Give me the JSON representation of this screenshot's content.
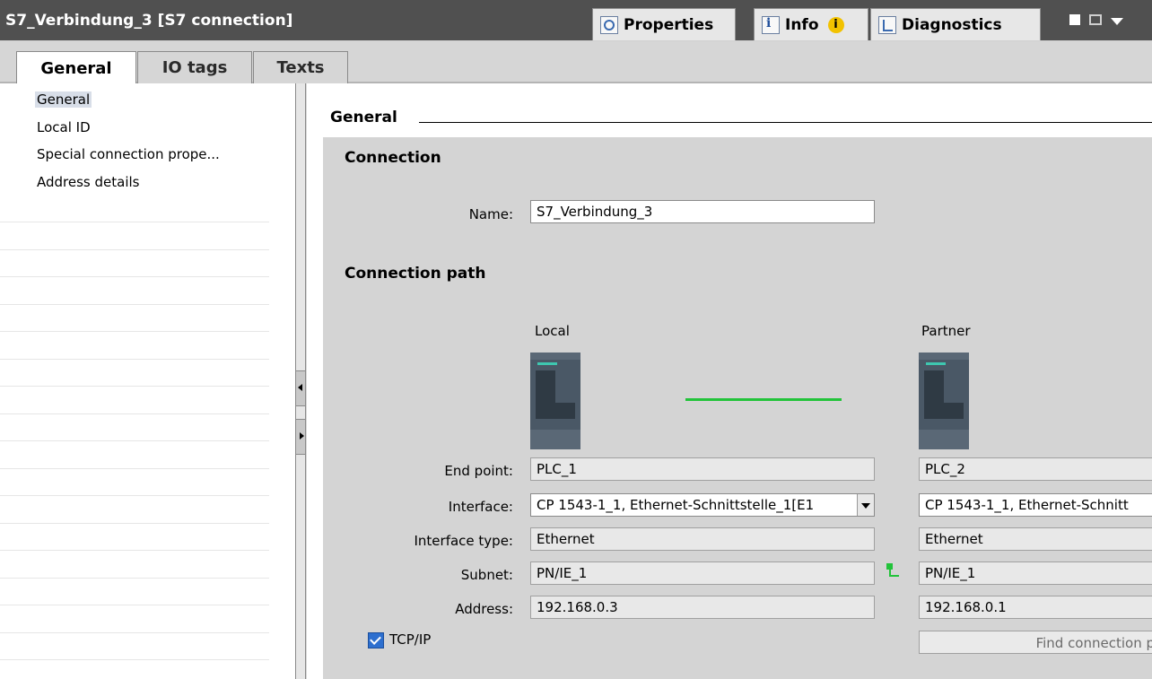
{
  "window": {
    "title": "S7_Verbindung_3 [S7 connection]",
    "tabs": [
      {
        "label": "Properties",
        "icon": "properties-icon"
      },
      {
        "label": "Info",
        "icon": "info-icon"
      },
      {
        "label": "Diagnostics",
        "icon": "diagnostics-icon"
      }
    ],
    "info_badge": "i"
  },
  "subtabs": [
    "General",
    "IO tags",
    "Texts"
  ],
  "sidebar": {
    "items": [
      {
        "label": "General"
      },
      {
        "label": "Local ID"
      },
      {
        "label": "Special connection prope..."
      },
      {
        "label": "Address details"
      }
    ]
  },
  "main": {
    "section_title": "General",
    "connection": {
      "heading": "Connection",
      "name_label": "Name:",
      "name_value": "S7_Verbindung_3"
    },
    "path": {
      "heading": "Connection path",
      "local_label": "Local",
      "partner_label": "Partner",
      "rows": [
        {
          "label": "End point:",
          "local": "PLC_1",
          "partner": "PLC_2"
        },
        {
          "label": "Interface:",
          "local": "CP 1543-1_1, Ethernet-Schnittstelle_1[E1",
          "partner": "CP 1543-1_1, Ethernet-Schnitt"
        },
        {
          "label": "Interface type:",
          "local": "Ethernet",
          "partner": "Ethernet"
        },
        {
          "label": "Subnet:",
          "local": "PN/IE_1",
          "partner": "PN/IE_1"
        },
        {
          "label": "Address:",
          "local": "192.168.0.3",
          "partner": "192.168.0.1"
        }
      ],
      "tcpip_label": "TCP/IP",
      "find_button": "Find connection p"
    }
  },
  "colors": {
    "link_line": "#22c33a",
    "titlebar": "#505050",
    "checkbox": "#2d6fcf"
  }
}
